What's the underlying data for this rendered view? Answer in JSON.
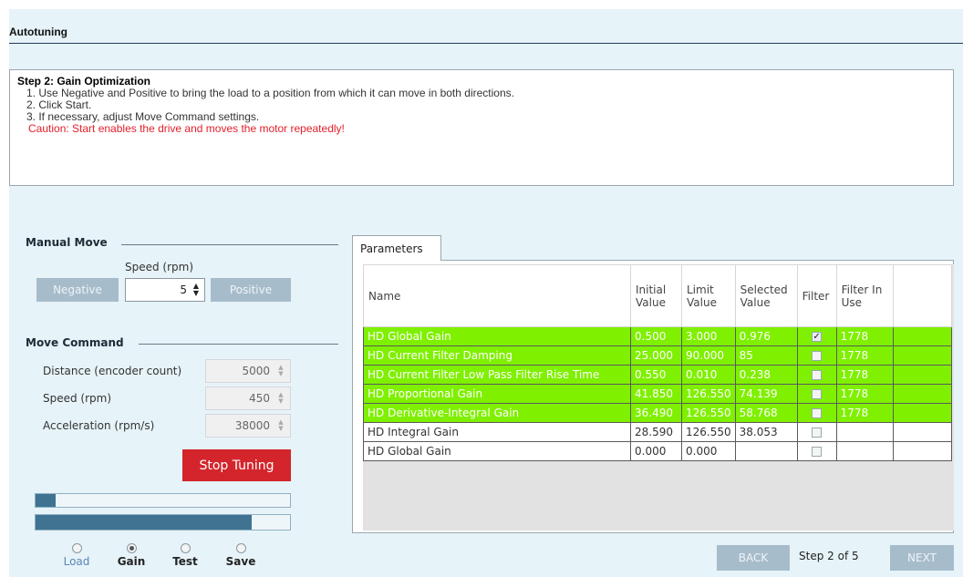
{
  "header": {
    "title": "Autotuning"
  },
  "instructions": {
    "title": "Step 2: Gain Optimization",
    "lines": [
      "1. Use Negative and Positive to bring the load to a position from which it can move in both directions.",
      "2. Click Start.",
      "3. If necessary, adjust Move Command settings."
    ],
    "caution": "Caution:  Start enables the drive and moves the motor repeatedly!"
  },
  "manual_move": {
    "title": "Manual Move",
    "speed_label": "Speed (rpm)",
    "speed_value": "5",
    "negative_label": "Negative",
    "positive_label": "Positive"
  },
  "move_command": {
    "title": "Move Command",
    "fields": [
      {
        "label": "Distance (encoder count)",
        "value": "5000"
      },
      {
        "label": "Speed (rpm)",
        "value": "450"
      },
      {
        "label": "Acceleration (rpm/s)",
        "value": "38000"
      }
    ],
    "stop_label": "Stop Tuning"
  },
  "progress": {
    "bar1_fraction": 0.08,
    "bar2_fraction": 0.85
  },
  "steps": [
    {
      "label": "Load",
      "selected": false
    },
    {
      "label": "Gain",
      "selected": true
    },
    {
      "label": "Test",
      "selected": false
    },
    {
      "label": "Save",
      "selected": false
    }
  ],
  "parameters": {
    "tab_label": "Parameters",
    "columns": [
      "Name",
      "Initial Value",
      "Limit Value",
      "Selected Value",
      "Filter",
      "Filter In Use"
    ],
    "rows": [
      {
        "name": "HD Global Gain",
        "initial": "0.500",
        "limit": "3.000",
        "selected": "0.976",
        "filter": true,
        "in_use": "1778",
        "highlight": true
      },
      {
        "name": "HD Current Filter Damping",
        "initial": "25.000",
        "limit": "90.000",
        "selected": "85",
        "filter": false,
        "in_use": "1778",
        "highlight": true
      },
      {
        "name": "HD Current Filter Low Pass Filter Rise Time",
        "initial": "0.550",
        "limit": "0.010",
        "selected": "0.238",
        "filter": false,
        "in_use": "1778",
        "highlight": true
      },
      {
        "name": "HD Proportional Gain",
        "initial": "41.850",
        "limit": "126.550",
        "selected": "74.139",
        "filter": false,
        "in_use": "1778",
        "highlight": true
      },
      {
        "name": "HD Derivative-Integral Gain",
        "initial": "36.490",
        "limit": "126.550",
        "selected": "58.768",
        "filter": false,
        "in_use": "1778",
        "highlight": true
      },
      {
        "name": "HD Integral Gain",
        "initial": "28.590",
        "limit": "126.550",
        "selected": "38.053",
        "filter": false,
        "in_use": "",
        "highlight": false
      },
      {
        "name": "HD Global Gain",
        "initial": "0.000",
        "limit": "0.000",
        "selected": "",
        "filter": false,
        "in_use": "",
        "highlight": false
      }
    ]
  },
  "navigation": {
    "back_label": "BACK",
    "next_label": "NEXT",
    "step_word": "Step",
    "step_current": "2",
    "step_of": "of",
    "step_total": "5"
  },
  "colors": {
    "background": "#e6f3f8",
    "highlight_row": "#7ff000",
    "stop_button": "#d3252b",
    "disabled_button": "#a7bccb",
    "caution_text": "#e4202a",
    "progress_fill": "#3f7391"
  }
}
